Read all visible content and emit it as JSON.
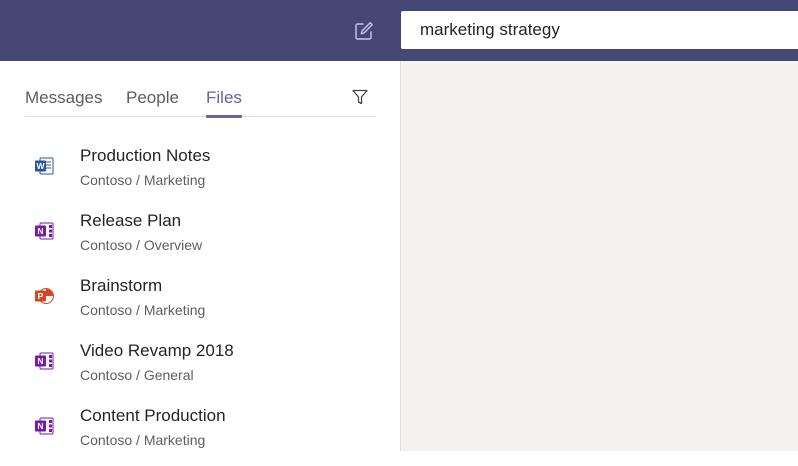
{
  "header": {
    "compose_icon": "compose-icon",
    "search": {
      "value": "marketing strategy",
      "placeholder": ""
    }
  },
  "tabs": [
    {
      "label": "Messages",
      "active": false
    },
    {
      "label": "People",
      "active": false
    },
    {
      "label": "Files",
      "active": true
    }
  ],
  "filter_icon": "filter-icon",
  "colors": {
    "header_bg": "#464775",
    "accent": "#6264a7",
    "word": "#2b579a",
    "onenote": "#7719aa",
    "powerpoint": "#d24726",
    "right_panel_bg": "#f3f2f1"
  },
  "files": [
    {
      "name": "Production Notes",
      "path": "Contoso / Marketing",
      "type": "word",
      "icon": "word-icon"
    },
    {
      "name": "Release Plan",
      "path": "Contoso / Overview",
      "type": "onenote",
      "icon": "onenote-icon"
    },
    {
      "name": "Brainstorm",
      "path": "Contoso / Marketing",
      "type": "powerpoint",
      "icon": "powerpoint-icon"
    },
    {
      "name": "Video Revamp 2018",
      "path": "Contoso / General",
      "type": "onenote",
      "icon": "onenote-icon"
    },
    {
      "name": "Content Production",
      "path": "Contoso / Marketing",
      "type": "onenote",
      "icon": "onenote-icon"
    }
  ]
}
